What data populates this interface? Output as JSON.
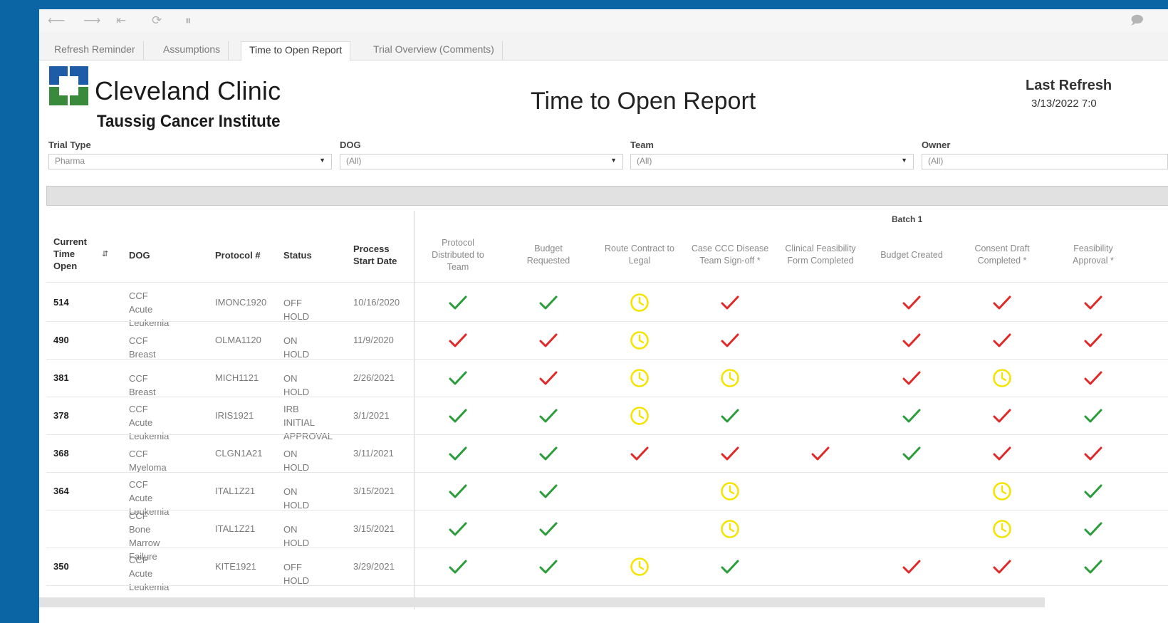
{
  "toolbar": {
    "icons": [
      "undo-icon",
      "redo-icon",
      "revert-icon",
      "refresh-icon",
      "pause-icon",
      "comment-icon"
    ]
  },
  "tabs": [
    {
      "label": "Refresh Reminder",
      "active": false
    },
    {
      "label": "Assumptions",
      "active": false
    },
    {
      "label": "Time to Open Report",
      "active": true
    },
    {
      "label": "Trial Overview (Comments)",
      "active": false
    }
  ],
  "header": {
    "logo_name": "Cleveland Clinic",
    "logo_sub": "Taussig Cancer Institute",
    "title": "Time to Open Report",
    "refresh_label": "Last Refresh",
    "refresh_value": "3/13/2022 7:0"
  },
  "filters": [
    {
      "label": "Trial Type",
      "value": "Pharma"
    },
    {
      "label": "DOG",
      "value": "(All)"
    },
    {
      "label": "Team",
      "value": "(All)"
    },
    {
      "label": "Owner",
      "value": "(All)"
    }
  ],
  "table": {
    "batch_label": "Batch 1",
    "left_headers": {
      "time_open": [
        "Current",
        "Time",
        "Open"
      ],
      "dog": "DOG",
      "protocol": "Protocol #",
      "status": "Status",
      "process_start": [
        "Process",
        "Start Date"
      ]
    },
    "milestone_headers": [
      [
        "Protocol",
        "Distributed to",
        "Team"
      ],
      [
        "Budget",
        "Requested"
      ],
      [
        "Route Contract to",
        "Legal"
      ],
      [
        "Case CCC Disease",
        "Team Sign-off *"
      ],
      [
        "Clinical Feasibility",
        "Form Completed"
      ],
      [
        "Budget Created"
      ],
      [
        "Consent Draft",
        "Completed *"
      ],
      [
        "Feasibility",
        "Approval *"
      ]
    ],
    "rows": [
      {
        "time": "514",
        "dog": [
          "CCF Acute",
          "Leukemia"
        ],
        "protocol": "IMONC1920",
        "status": [
          "OFF HOLD"
        ],
        "start": "10/16/2020",
        "marks": [
          "check-green",
          "check-green",
          "clock-yellow",
          "check-red",
          "",
          "check-red",
          "check-red",
          "check-red"
        ]
      },
      {
        "time": "490",
        "dog": [
          "CCF Breast"
        ],
        "protocol": "OLMA1120",
        "status": [
          "ON HOLD"
        ],
        "start": "11/9/2020",
        "marks": [
          "check-red",
          "check-red",
          "clock-yellow",
          "check-red",
          "",
          "check-red",
          "check-red",
          "check-red"
        ]
      },
      {
        "time": "381",
        "dog": [
          "CCF Breast"
        ],
        "protocol": "MICH1121",
        "status": [
          "ON HOLD"
        ],
        "start": "2/26/2021",
        "marks": [
          "check-green",
          "check-red",
          "clock-yellow",
          "clock-yellow",
          "",
          "check-red",
          "clock-yellow",
          "check-red"
        ]
      },
      {
        "time": "378",
        "dog": [
          "CCF Acute",
          "Leukemia"
        ],
        "protocol": "IRIS1921",
        "status": [
          "IRB INITIAL",
          "APPROVAL"
        ],
        "start": "3/1/2021",
        "marks": [
          "check-green",
          "check-green",
          "clock-yellow",
          "check-green",
          "",
          "check-green",
          "check-red",
          "check-green"
        ]
      },
      {
        "time": "368",
        "dog": [
          "CCF Myeloma"
        ],
        "protocol": "CLGN1A21",
        "status": [
          "ON HOLD"
        ],
        "start": "3/11/2021",
        "marks": [
          "check-green",
          "check-green",
          "check-red",
          "check-red",
          "check-red",
          "check-green",
          "check-red",
          "check-red"
        ]
      },
      {
        "time": "364",
        "dog": [
          "CCF Acute",
          "Leukemia"
        ],
        "protocol": "ITAL1Z21",
        "status": [
          "ON HOLD"
        ],
        "start": "3/15/2021",
        "marks": [
          "check-green",
          "check-green",
          "",
          "clock-yellow",
          "",
          "",
          "clock-yellow",
          "check-green"
        ]
      },
      {
        "time": "",
        "dog": [
          "CCF Bone",
          "Marrow",
          "Failure"
        ],
        "protocol": "ITAL1Z21",
        "status": [
          "ON HOLD"
        ],
        "start": "3/15/2021",
        "marks": [
          "check-green",
          "check-green",
          "",
          "clock-yellow",
          "",
          "",
          "clock-yellow",
          "check-green"
        ]
      },
      {
        "time": "350",
        "dog": [
          "CCF Acute",
          "Leukemia"
        ],
        "protocol": "KITE1921",
        "status": [
          "OFF HOLD"
        ],
        "start": "3/29/2021",
        "marks": [
          "check-green",
          "check-green",
          "clock-yellow",
          "check-green",
          "",
          "check-red",
          "check-red",
          "check-green"
        ]
      }
    ]
  },
  "colors": {
    "background": "#0b64a4",
    "check_green": "#2a9d3a",
    "check_red": "#e02a2a",
    "clock_yellow": "#f5e400",
    "logo_green": "#3a8a3c",
    "logo_blue": "#1f5ca8"
  }
}
